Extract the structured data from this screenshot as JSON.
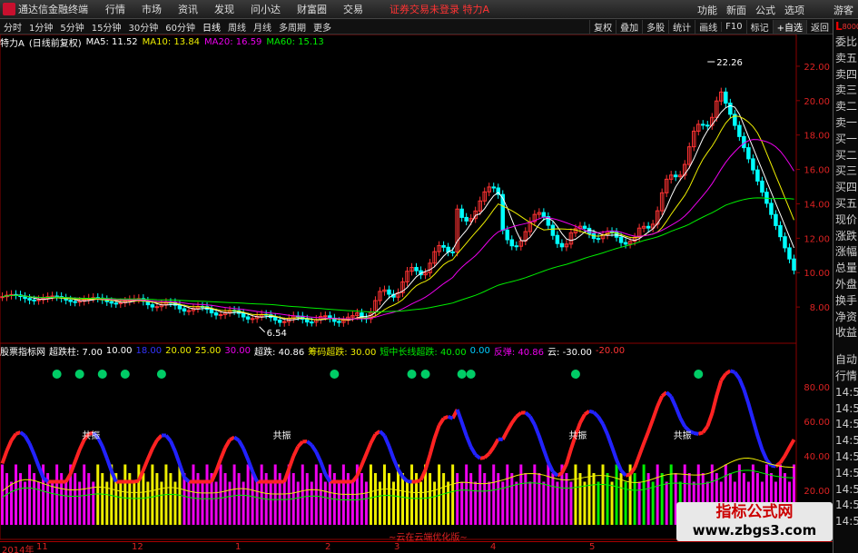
{
  "titlebar": {
    "app": "通达信金融终端",
    "menus": [
      "行情",
      "市场",
      "资讯",
      "发现",
      "问小达",
      "财富圈",
      "交易"
    ],
    "warning": "证券交易未登录 特力A",
    "right": [
      "功能",
      "新面",
      "公式",
      "选项"
    ],
    "guest": "游客"
  },
  "period_bar": {
    "periods": [
      "分时",
      "1分钟",
      "5分钟",
      "15分钟",
      "30分钟",
      "60分钟",
      "日线",
      "周线",
      "月线",
      "多周期",
      "更多"
    ],
    "active": "日线",
    "tools": [
      "复权",
      "叠加",
      "多股",
      "统计",
      "画线",
      "F10",
      "标记",
      "+自选",
      "返回"
    ]
  },
  "legend": {
    "name": "特力A",
    "mode": "(日线前复权)",
    "ma5": "MA5: 11.52",
    "ma10": "MA10: 13.84",
    "ma20": "MA20: 16.59",
    "ma60": "MA60: 15.13"
  },
  "price_axis": [
    "22.00",
    "20.00",
    "18.00",
    "16.00",
    "14.00",
    "12.00",
    "10.00",
    "8.00"
  ],
  "price_marks": {
    "high": "22.26",
    "low": "6.54"
  },
  "chart_data": {
    "type": "candlestick",
    "ylim": [
      6,
      23
    ],
    "high_label": 22.26,
    "low_label": 6.54
  },
  "indicator": {
    "name": "股票指标网",
    "items": [
      "超跌柱: 7.00",
      "10.00",
      "18.00",
      "20.00",
      "25.00",
      "30.00",
      "超跌: 40.86",
      "筹码超跌: 30.00",
      "短中长线超跌: 40.00",
      "0.00",
      "反弹: 40.86",
      "云: -30.00",
      "-20.00"
    ],
    "axis": [
      "80.00",
      "60.00",
      "40.00",
      "20.00"
    ]
  },
  "indicator_labels": {
    "mark1": "共振",
    "mark2": "共振",
    "mark3": "共振",
    "mark4": "共振"
  },
  "sidebar": {
    "header_l": "L",
    "header_c": "8000",
    "items": [
      "委比",
      "卖五",
      "卖四",
      "卖三",
      "卖二",
      "卖一",
      "买一",
      "买二",
      "买三",
      "买四",
      "买五",
      "现价",
      "涨跌",
      "涨幅",
      "总量",
      "外盘",
      "换手",
      "净资",
      "收益"
    ],
    "items2": [
      "自动",
      "行情",
      "14:5",
      "14:5",
      "14:5",
      "14:5",
      "14:5",
      "14:5",
      "14:5",
      "14:5",
      "14:5"
    ]
  },
  "dates": [
    {
      "t": "2014年",
      "x": 2
    },
    {
      "t": "11",
      "x": 40
    },
    {
      "t": "12",
      "x": 145
    },
    {
      "t": "1",
      "x": 259
    },
    {
      "t": "2",
      "x": 358
    },
    {
      "t": "3",
      "x": 434
    },
    {
      "t": "4",
      "x": 540
    },
    {
      "t": "5",
      "x": 649
    }
  ],
  "center_tag": "~云在云端优化版~",
  "watermark": {
    "line1": "指标公式网",
    "line2": "www.zbgs3.com"
  }
}
